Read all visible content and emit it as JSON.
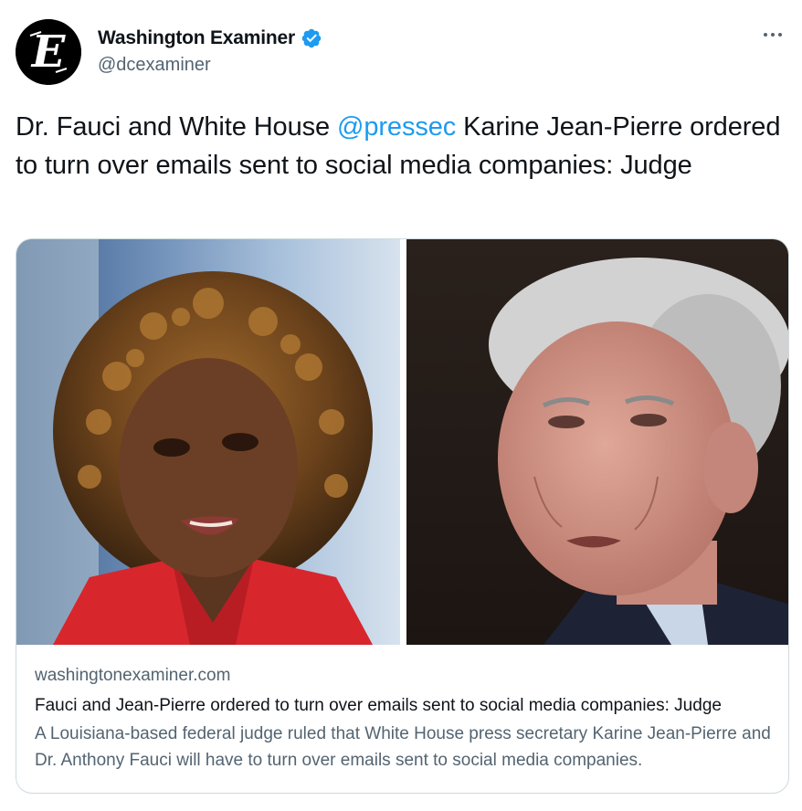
{
  "account": {
    "display_name": "Washington Examiner",
    "handle": "@dcexaminer",
    "verified": true,
    "avatar_icon": "gothic-e-logo-icon",
    "avatar_letter": "E"
  },
  "menu": {
    "icon": "more-horizontal-icon"
  },
  "tweet": {
    "text_before": "Dr. Fauci and White House ",
    "mention": "@pressec",
    "text_after": " Karine Jean-Pierre ordered to turn over emails sent to social media companies: Judge"
  },
  "card": {
    "domain": "washingtonexaminer.com",
    "title": "Fauci and Jean-Pierre ordered to turn over emails sent to social media companies: Judge",
    "description": "A Louisiana-based federal judge ruled that White House press secretary Karine Jean-Pierre and Dr. Anthony Fauci will have to turn over emails sent to social media companies."
  },
  "colors": {
    "accent": "#1d9bf0",
    "text_primary": "#0f1419",
    "text_secondary": "#536471",
    "border": "#cfd9de"
  }
}
